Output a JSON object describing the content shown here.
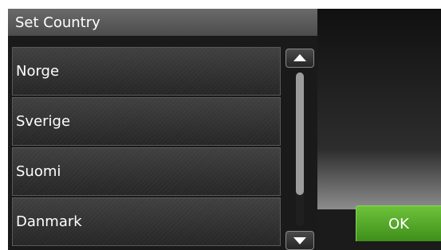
{
  "header": {
    "title": "Set Country"
  },
  "list": {
    "items": [
      {
        "label": "Norge"
      },
      {
        "label": "Sverige"
      },
      {
        "label": "Suomi"
      },
      {
        "label": "Danmark"
      }
    ]
  },
  "scrollbar": {
    "up_icon": "triangle-up-icon",
    "down_icon": "triangle-down-icon",
    "thumb_visible_fraction": 0.8,
    "thumb_position_fraction": 0.0
  },
  "actions": {
    "ok_label": "OK"
  },
  "colors": {
    "ok_button": "#4fa626",
    "background": "#111111"
  }
}
